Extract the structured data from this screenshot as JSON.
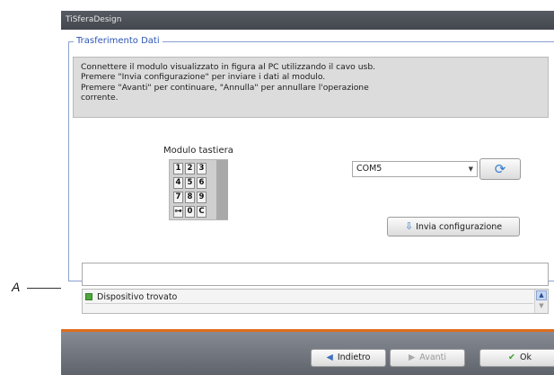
{
  "callout": {
    "label": "A"
  },
  "window": {
    "title": "TiSferaDesign"
  },
  "group": {
    "title": "Trasferimento Dati"
  },
  "info_lines": [
    "Connettere il modulo visualizzato in figura al PC utilizzando il cavo usb.",
    "Premere \"Invia configurazione\" per inviare i dati al modulo.",
    "Premere \"Avanti\" per continuare, \"Annulla\" per annullare l'operazione",
    "corrente."
  ],
  "module": {
    "title": "Modulo tastiera",
    "keys": [
      "1",
      "2",
      "3",
      "4",
      "5",
      "6",
      "7",
      "8",
      "9",
      "⊶",
      "0",
      "C"
    ]
  },
  "port": {
    "selected": "COM5"
  },
  "buttons": {
    "send": "Invia configurazione",
    "back": "Indietro",
    "next": "Avanti",
    "ok": "Ok"
  },
  "status": {
    "text": "Dispositivo trovato",
    "color": "#4caa3c"
  },
  "colors": {
    "accent": "#e06c1c",
    "group_border": "#8aa0cf"
  }
}
